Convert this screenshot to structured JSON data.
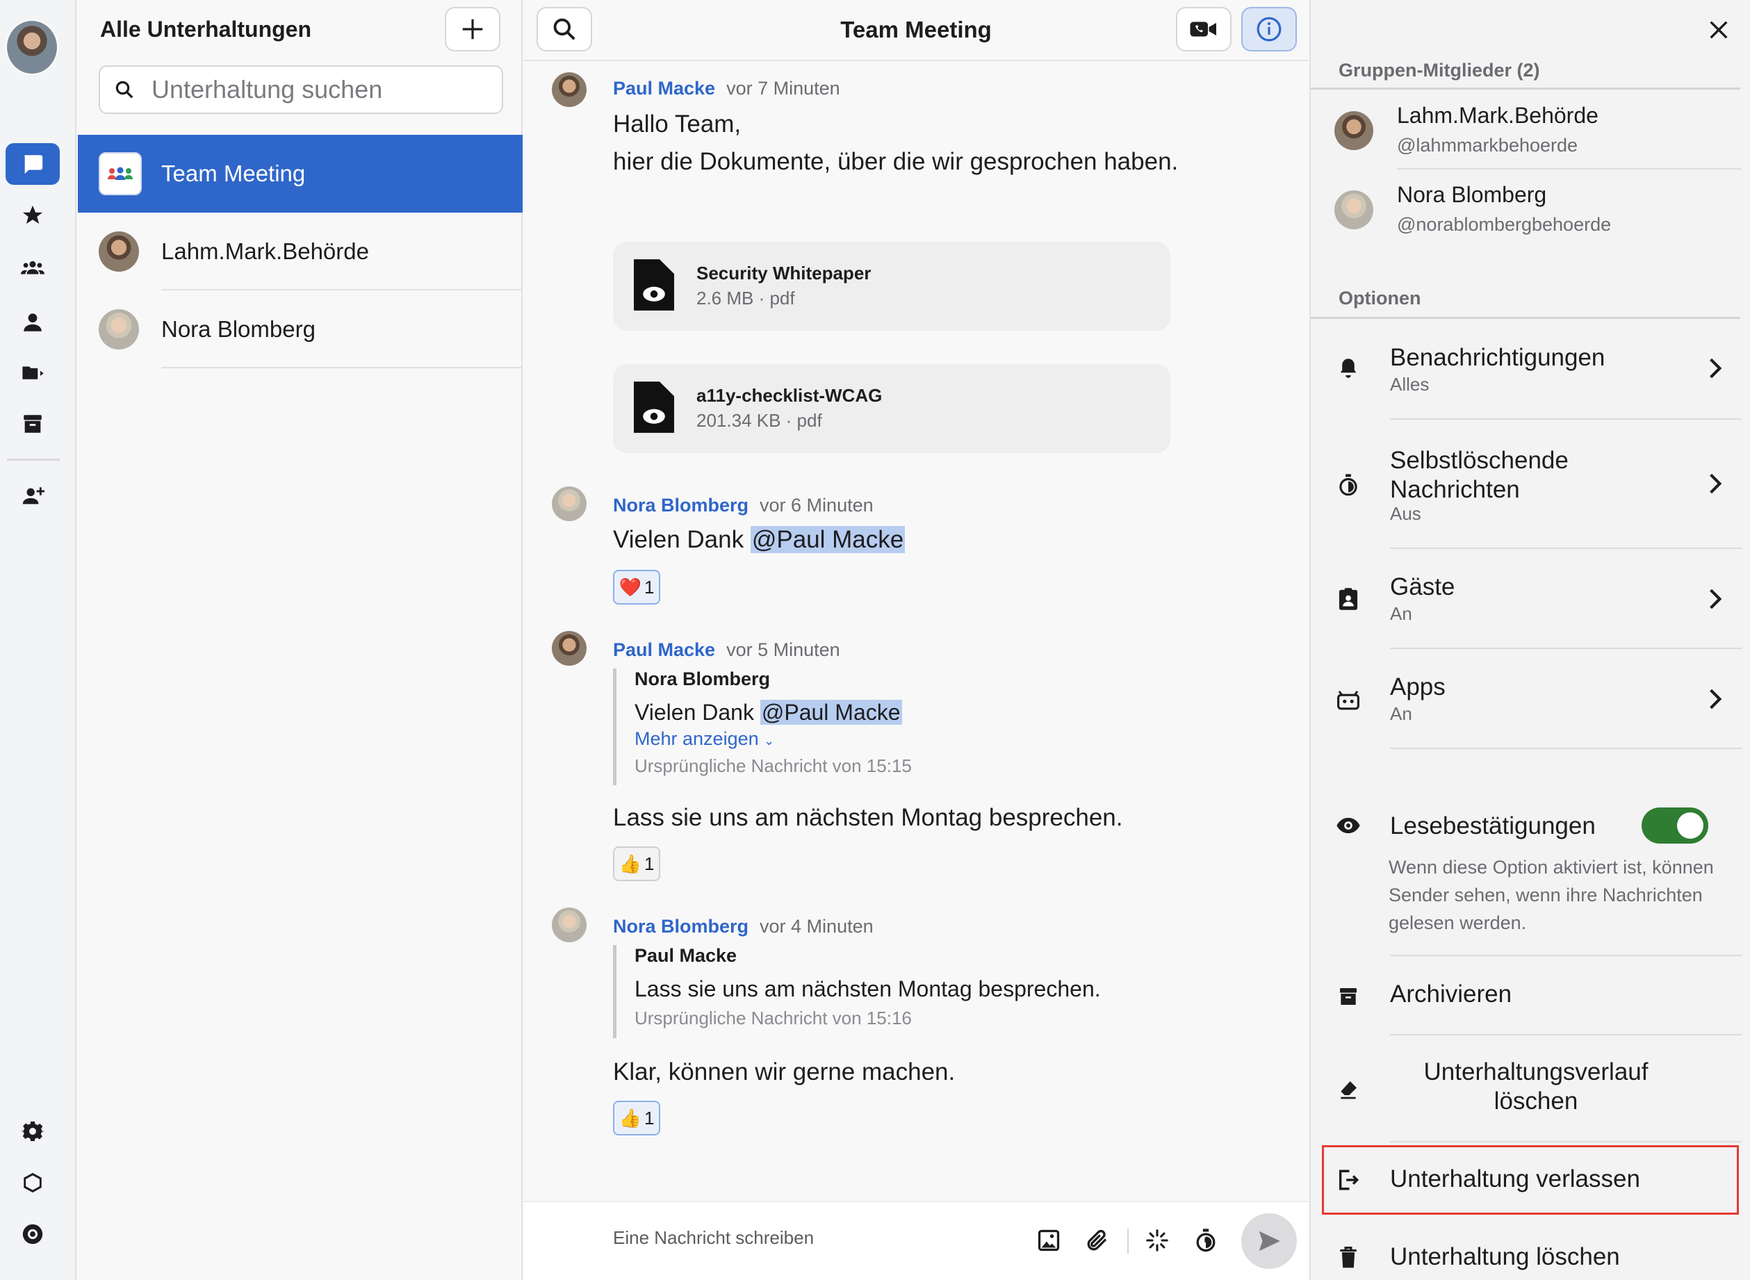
{
  "nav": {
    "items": [
      "chat-icon",
      "star-icon",
      "people-icon",
      "person-icon",
      "folder-icon",
      "archive-icon",
      "add-person-icon",
      "gear-icon",
      "hexagon-icon",
      "lifebuoy-icon"
    ]
  },
  "sidebar": {
    "title": "Alle Unterhaltungen",
    "search_placeholder": "Unterhaltung suchen",
    "conversations": [
      {
        "label": "Team Meeting"
      },
      {
        "label": "Lahm.Mark.Behörde"
      },
      {
        "label": "Nora Blomberg"
      }
    ]
  },
  "chat": {
    "title": "Team Meeting",
    "composer_placeholder": "Eine Nachricht schreiben",
    "messages": [
      {
        "author": "Paul Macke",
        "time": "vor 7 Minuten",
        "line1": "Hallo Team,",
        "line2": "hier die Dokumente, über die wir gesprochen haben."
      },
      {
        "author": "Nora Blomberg",
        "time": "vor 6 Minuten",
        "text": "Vielen Dank ",
        "mention": "@Paul Macke",
        "reaction": "❤️",
        "reaction_count": "1"
      },
      {
        "author": "Paul Macke",
        "time": "vor 5 Minuten",
        "quote_author": "Nora Blomberg",
        "quote_text": "Vielen Dank ",
        "quote_mention": "@Paul Macke",
        "show_more": "Mehr anzeigen",
        "original": "Ursprüngliche Nachricht von 15:15",
        "text": "Lass sie uns am nächsten Montag besprechen.",
        "reaction": "👍",
        "reaction_count": "1"
      },
      {
        "author": "Nora Blomberg",
        "time": "vor 4 Minuten",
        "quote_author": "Paul Macke",
        "quote_text": "Lass sie uns am nächsten Montag besprechen.",
        "original": "Ursprüngliche Nachricht von 15:16",
        "text": "Klar, können wir gerne machen.",
        "reaction": "👍",
        "reaction_count": "1"
      }
    ],
    "files": [
      {
        "name": "Security Whitepaper",
        "meta": "2.6 MB · pdf"
      },
      {
        "name": "a11y-checklist-WCAG",
        "meta": "201.34 KB · pdf"
      }
    ]
  },
  "panel": {
    "members_heading": "Gruppen-Mitglieder (2)",
    "members": [
      {
        "name": "Lahm.Mark.Behörde",
        "handle": "@lahmmarkbehoerde"
      },
      {
        "name": "Nora Blomberg",
        "handle": "@norablombergbehoerde"
      }
    ],
    "options_heading": "Optionen",
    "notifications": {
      "label": "Benachrichtigungen",
      "value": "Alles"
    },
    "self_delete": {
      "label1": "Selbstlöschende",
      "label2": "Nachrichten",
      "value": "Aus"
    },
    "guests": {
      "label": "Gäste",
      "value": "An"
    },
    "apps": {
      "label": "Apps",
      "value": "An"
    },
    "read_receipts": {
      "label": "Lesebestätigungen",
      "enabled": true,
      "description": "Wenn diese Option aktiviert ist, können Sender sehen, wenn ihre Nachrichten gelesen werden."
    },
    "archive": "Archivieren",
    "clear_history": {
      "line1": "Unterhaltungsverlauf",
      "line2": "löschen"
    },
    "leave": "Unterhaltung verlassen",
    "delete": "Unterhaltung löschen"
  },
  "colors": {
    "accent": "#2f66c9",
    "toggle_on": "#2e7d32",
    "highlight": "#e53935"
  }
}
